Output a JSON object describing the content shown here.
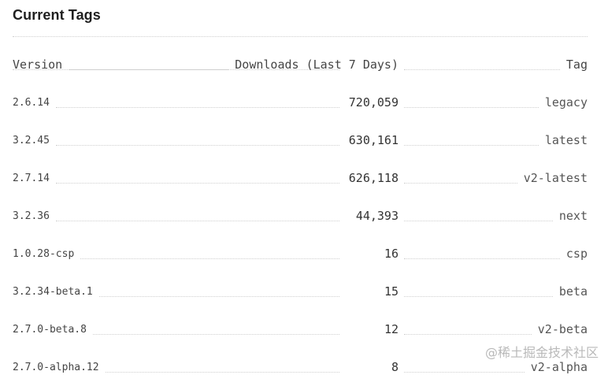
{
  "section": {
    "title": "Current Tags"
  },
  "table": {
    "headers": {
      "version": "Version",
      "downloads": "Downloads (Last 7 Days)",
      "tag": "Tag"
    },
    "rows": [
      {
        "version": "2.6.14",
        "downloads": "720,059",
        "tag": "legacy"
      },
      {
        "version": "3.2.45",
        "downloads": "630,161",
        "tag": "latest"
      },
      {
        "version": "2.7.14",
        "downloads": "626,118",
        "tag": "v2-latest"
      },
      {
        "version": "3.2.36",
        "downloads": "44,393",
        "tag": "next"
      },
      {
        "version": "1.0.28-csp",
        "downloads": "16",
        "tag": "csp"
      },
      {
        "version": "3.2.34-beta.1",
        "downloads": "15",
        "tag": "beta"
      },
      {
        "version": "2.7.0-beta.8",
        "downloads": "12",
        "tag": "v2-beta"
      },
      {
        "version": "2.7.0-alpha.12",
        "downloads": "8",
        "tag": "v2-alpha"
      }
    ]
  },
  "watermark": {
    "text": "@稀土掘金技术社区"
  }
}
